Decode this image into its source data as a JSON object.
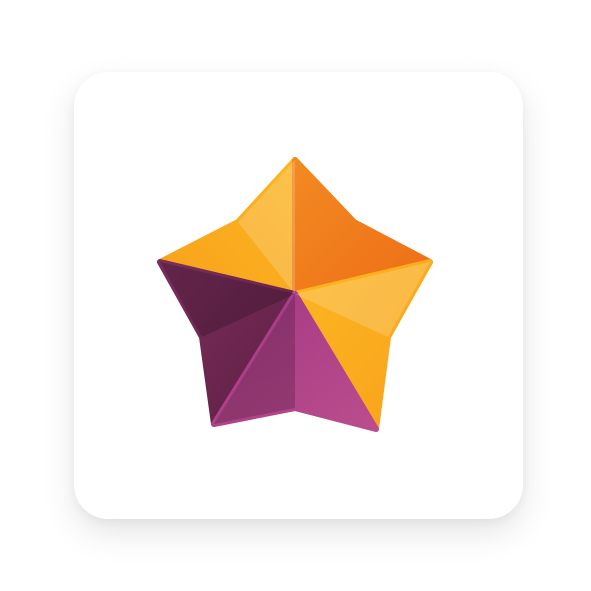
{
  "icon": {
    "name": "star-icon",
    "colors": {
      "orange_light": "#FCB623",
      "orange": "#F8A21A",
      "orange_dark": "#EE6E16",
      "orange_mid": "#F28A22",
      "plum_dark": "#5E1F43",
      "plum": "#7A2E5C",
      "magenta": "#A43884",
      "magenta_light": "#BA4D8C",
      "tile_background": "#FFFFFF"
    }
  }
}
